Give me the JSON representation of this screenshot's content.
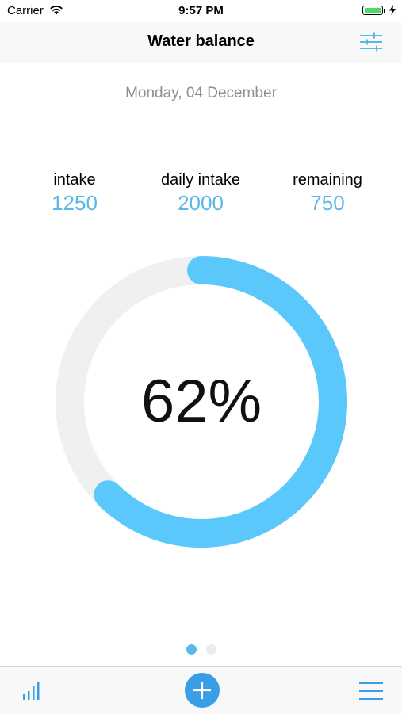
{
  "status_bar": {
    "carrier": "Carrier",
    "time": "9:57 PM"
  },
  "nav": {
    "title": "Water balance",
    "settings_icon": "sliders-icon"
  },
  "date": "Monday, 04 December",
  "stats": [
    {
      "label": "intake",
      "value": "1250"
    },
    {
      "label": "daily intake",
      "value": "2000"
    },
    {
      "label": "remaining",
      "value": "750"
    }
  ],
  "progress": {
    "percent_label": "62%",
    "fraction": 0.625
  },
  "pager": {
    "pages": 2,
    "current": 0
  },
  "tab_bar": {
    "left_icon": "bar-chart-icon",
    "center_icon": "plus-icon",
    "right_icon": "menu-icon"
  },
  "colors": {
    "accent": "#5ac8fa",
    "value_text": "#5ab8e6",
    "track": "#f0f0f0",
    "add_button": "#3a9ee6",
    "battery": "#4cd964"
  }
}
